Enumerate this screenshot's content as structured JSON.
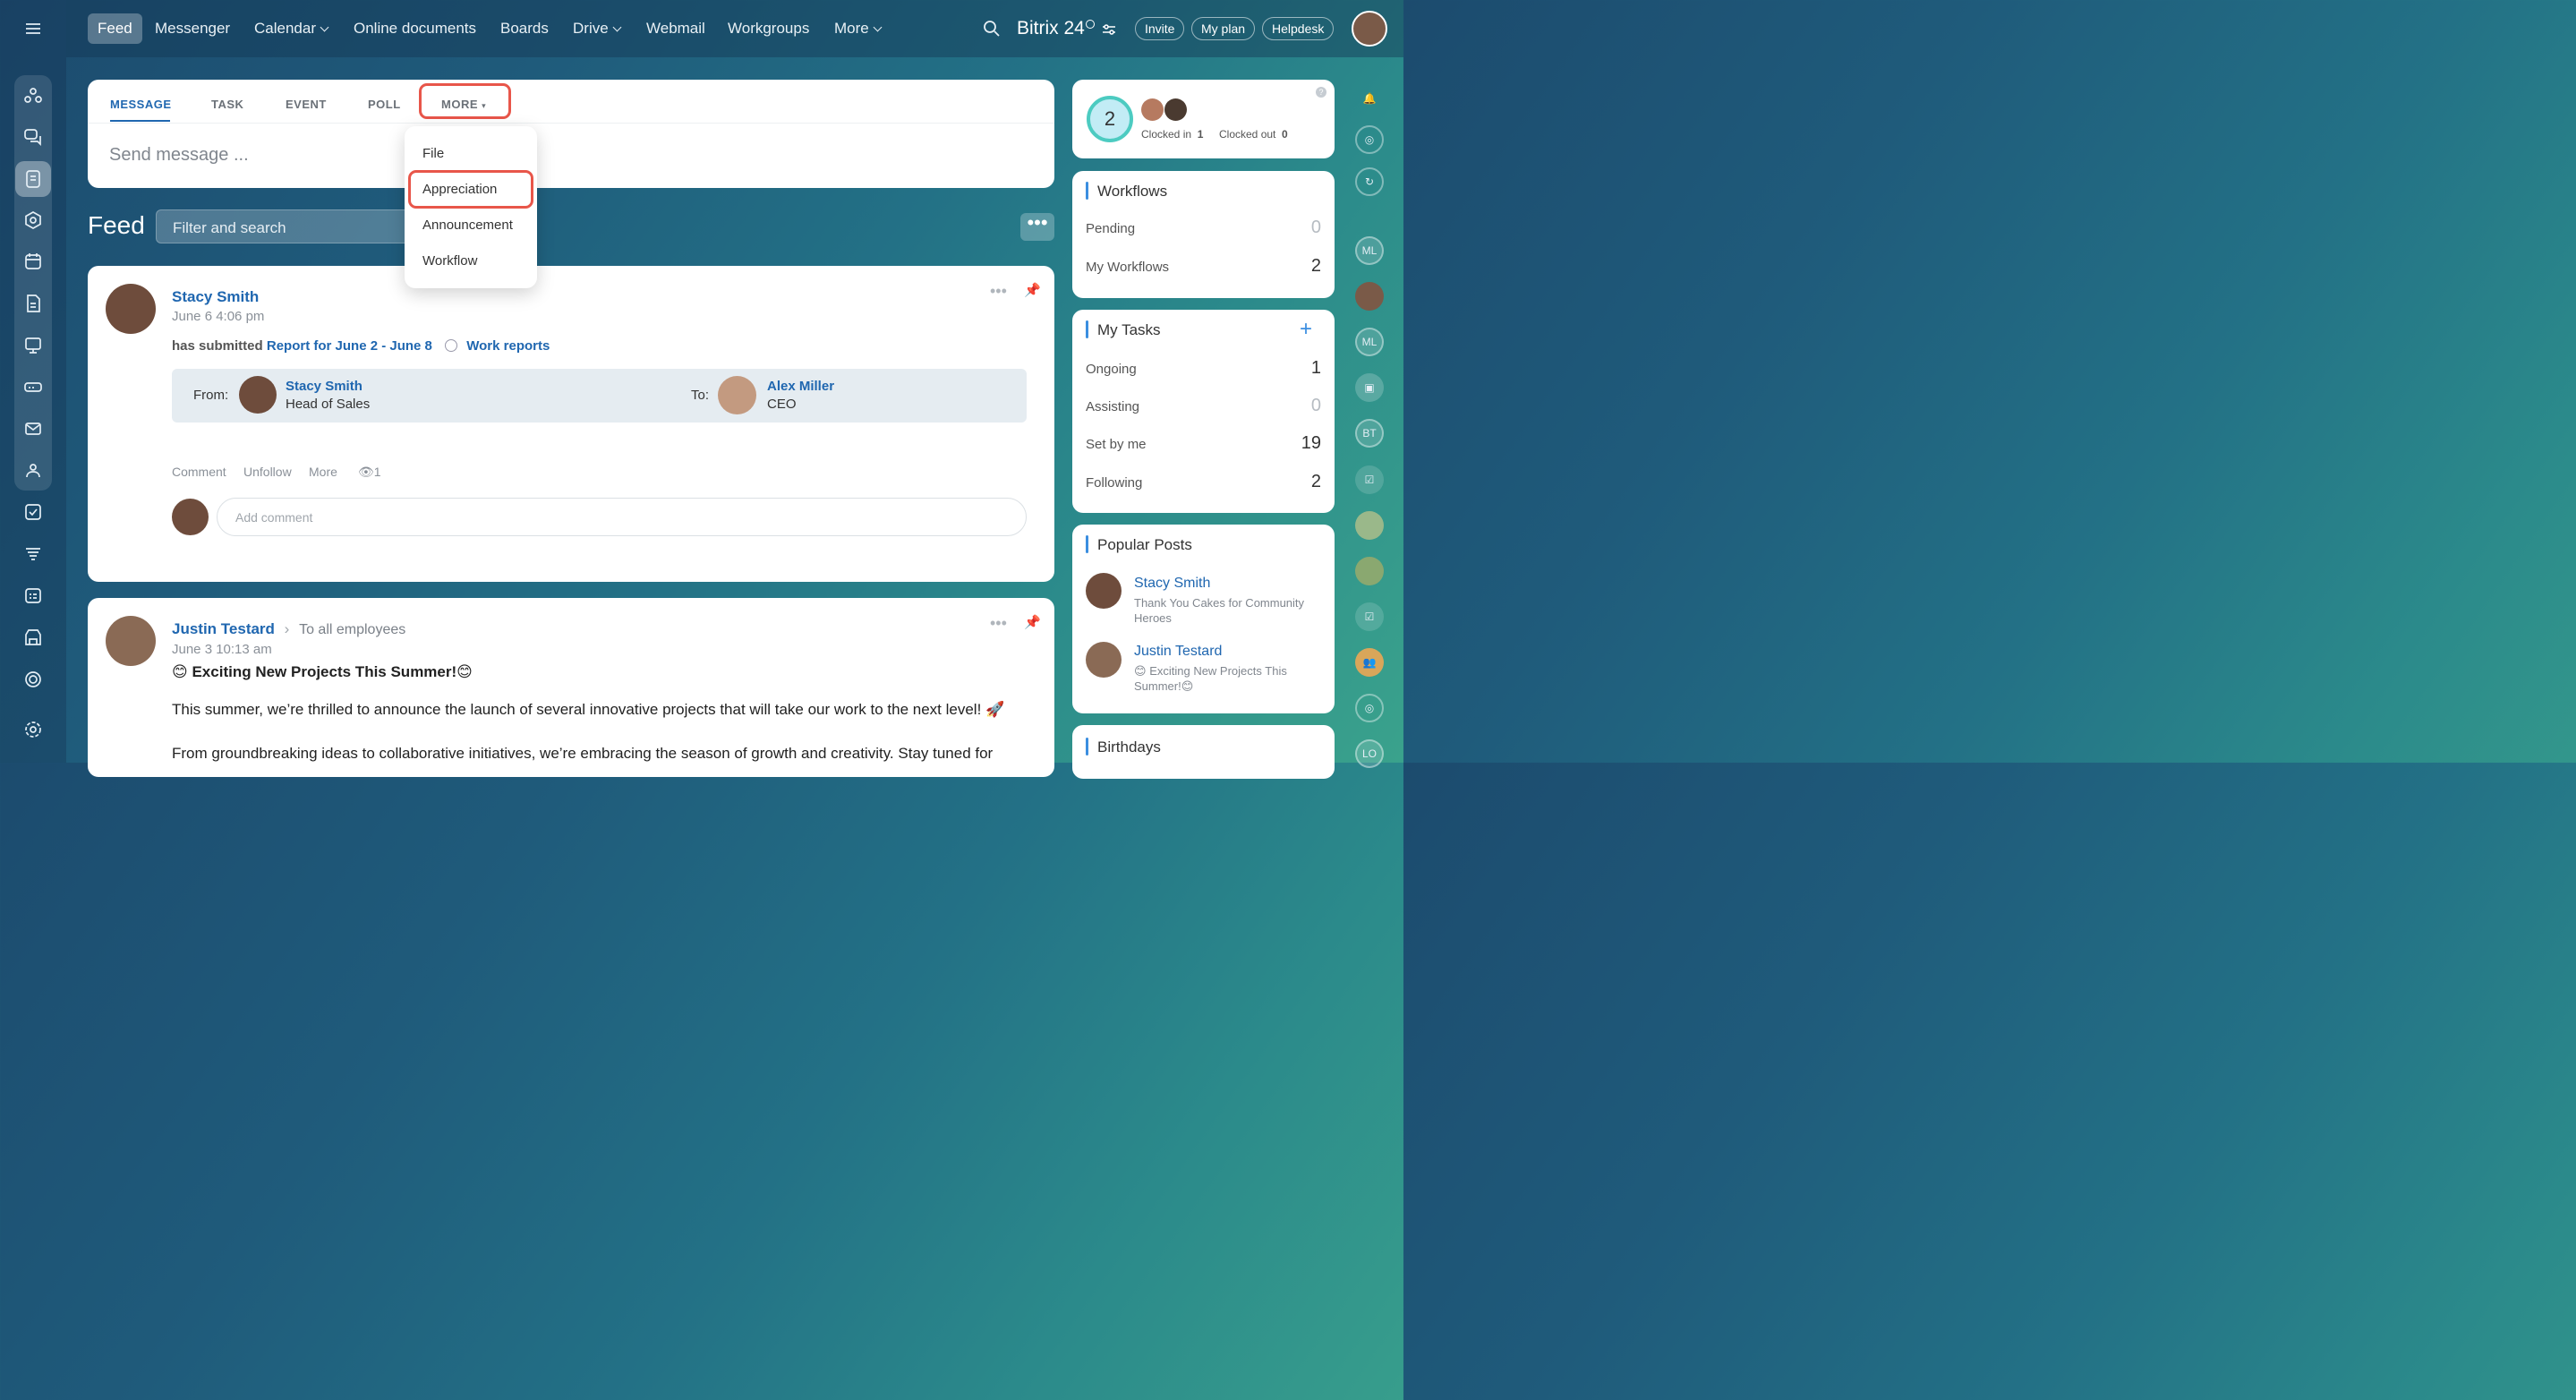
{
  "nav": {
    "items": [
      "Feed",
      "Messenger",
      "Calendar",
      "Online documents",
      "Boards",
      "Drive",
      "Webmail",
      "Workgroups",
      "More"
    ],
    "brand": "Bitrix 24",
    "invite": "Invite",
    "plan": "My plan",
    "helpdesk": "Helpdesk"
  },
  "composer": {
    "tabs": [
      "MESSAGE",
      "TASK",
      "EVENT",
      "POLL",
      "MORE"
    ],
    "placeholder": "Send message ...",
    "menu": [
      "File",
      "Appreciation",
      "Announcement",
      "Workflow"
    ]
  },
  "feed": {
    "title": "Feed",
    "filter_placeholder": "Filter and search"
  },
  "post1": {
    "author": "Stacy Smith",
    "date": "June 6 4:06 pm",
    "action": "has submitted",
    "report": "Report for June 2 - June 8",
    "category": "Work reports",
    "from_label": "From:",
    "from_name": "Stacy Smith",
    "from_role": "Head of Sales",
    "to_label": "To:",
    "to_name": "Alex Miller",
    "to_role": "CEO",
    "actions": [
      "Comment",
      "Unfollow",
      "More"
    ],
    "views": "1",
    "comment_placeholder": "Add comment"
  },
  "post2": {
    "author": "Justin Testard",
    "audience": "To all employees",
    "date": "June 3 10:13 am",
    "title": "Exciting New Projects This Summer!",
    "para1": "This summer, we’re thrilled to announce the launch of several innovative projects that will take our work to the next level! 🚀",
    "para2": "From groundbreaking ideas to collaborative initiatives, we’re embracing the season of growth and creativity. Stay tuned for"
  },
  "timeman": {
    "count": "2",
    "clocked_in_label": "Clocked in",
    "clocked_in": "1",
    "clocked_out_label": "Clocked out",
    "clocked_out": "0"
  },
  "workflows": {
    "title": "Workflows",
    "rows": [
      {
        "label": "Pending",
        "value": "0"
      },
      {
        "label": "My Workflows",
        "value": "2"
      }
    ]
  },
  "tasks": {
    "title": "My Tasks",
    "rows": [
      {
        "label": "Ongoing",
        "value": "1"
      },
      {
        "label": "Assisting",
        "value": "0"
      },
      {
        "label": "Set by me",
        "value": "19"
      },
      {
        "label": "Following",
        "value": "2"
      }
    ]
  },
  "popular": {
    "title": "Popular Posts",
    "items": [
      {
        "name": "Stacy Smith",
        "text": "Thank You Cakes for Community Heroes"
      },
      {
        "name": "Justin Testard",
        "text": "Exciting New Projects This Summer!"
      }
    ]
  },
  "birthdays": {
    "title": "Birthdays"
  },
  "right_rail": {
    "initials": [
      "ML",
      "ML",
      "BT",
      "LO"
    ]
  },
  "colors": {
    "accent": "#2067b0",
    "highlight": "#e8564a"
  }
}
